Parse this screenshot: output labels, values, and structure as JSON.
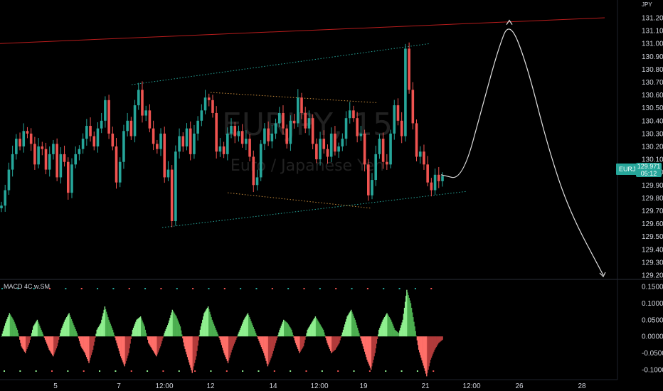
{
  "symbol": "EURJPY",
  "watermark": {
    "symbol": "EURJPY, 15",
    "description": "Euro / Japanese Yen"
  },
  "corner_label": "JPY",
  "last_price": {
    "label": "EURJPY",
    "value": "129.971",
    "countdown": "05:12"
  },
  "macd_title": "MACD 4C w.SM",
  "colors": {
    "background": "#000000",
    "candle_up": "#26a69a",
    "candle_down": "#ef5350",
    "channel_green": "#26a69a",
    "channel_orange": "#c68a3a",
    "resistance_red": "#b71c1c",
    "projection": "#e0e0e0",
    "macd_up": "#8ff08f",
    "macd_up_dark": "#4caf50",
    "macd_down": "#ff6f69",
    "macd_down_dark": "#b23b3b"
  },
  "chart_data": [
    {
      "type": "candlestick",
      "title": "EURJPY, 15",
      "y_axis": {
        "ylim": [
          129.2,
          131.2
        ],
        "ticks": [
          "131.200",
          "131.100",
          "131.000",
          "130.900",
          "130.800",
          "130.700",
          "130.600",
          "130.500",
          "130.400",
          "130.300",
          "130.200",
          "130.100",
          "130.000",
          "129.900",
          "129.800",
          "129.700",
          "129.600",
          "129.500",
          "129.400",
          "129.300",
          "129.200"
        ]
      },
      "x_axis": {
        "ticks": [
          "5",
          "7",
          "12:00",
          "12",
          "14",
          "12:00",
          "19",
          "21",
          "12:00",
          "26",
          "28"
        ]
      },
      "price_path_close": [
        129.74,
        129.86,
        130.02,
        130.14,
        130.26,
        130.2,
        130.32,
        130.3,
        130.22,
        130.06,
        130.2,
        130.18,
        130.02,
        130.14,
        130.22,
        129.96,
        130.14,
        130.08,
        129.84,
        130.06,
        130.14,
        130.18,
        130.26,
        130.36,
        130.28,
        130.2,
        130.34,
        130.4,
        130.56,
        130.3,
        130.2,
        129.92,
        130.08,
        130.32,
        130.4,
        130.28,
        130.52,
        130.64,
        130.44,
        130.48,
        130.34,
        130.22,
        130.18,
        130.3,
        129.96,
        130.02,
        129.62,
        130.16,
        130.28,
        130.2,
        130.34,
        130.14,
        130.3,
        130.4,
        130.48,
        130.58,
        130.56,
        130.46,
        130.16,
        130.2,
        130.14,
        130.3,
        130.36,
        130.28,
        130.32,
        130.22,
        130.26,
        130.12,
        129.9,
        129.96,
        130.22,
        130.34,
        130.24,
        130.3,
        130.38,
        130.46,
        130.34,
        130.22,
        130.4,
        130.38,
        130.58,
        130.46,
        130.34,
        130.42,
        130.22,
        130.1,
        130.26,
        130.18,
        130.12,
        130.3,
        130.16,
        130.2,
        130.26,
        130.42,
        130.48,
        130.42,
        130.28,
        130.3,
        130.06,
        129.82,
        129.94,
        130.14,
        130.26,
        130.08,
        130.06,
        130.3,
        130.52,
        130.4,
        130.28,
        130.96,
        130.64,
        130.38,
        130.12,
        130.16,
        130.06,
        129.92,
        129.86,
        129.98,
        129.93,
        129.97
      ],
      "annotations": [
        {
          "kind": "horizontal-resistance",
          "from": [
            0,
            131.0
          ],
          "to": [
            850,
            131.2
          ]
        },
        {
          "kind": "rising-channel-top",
          "from": [
            185,
            130.68
          ],
          "to": [
            605,
            131.0
          ]
        },
        {
          "kind": "rising-channel-bottom",
          "from": [
            228,
            129.57
          ],
          "to": [
            655,
            129.85
          ]
        },
        {
          "kind": "falling-wedge-top",
          "from": [
            296,
            130.62
          ],
          "to": [
            530,
            130.54
          ]
        },
        {
          "kind": "falling-wedge-bottom",
          "from": [
            320,
            129.84
          ],
          "to": [
            522,
            129.72
          ]
        },
        {
          "kind": "projection-path",
          "points": [
            [
              620,
              129.98
            ],
            [
              650,
              129.94
            ],
            [
              680,
              130.55
            ],
            [
              700,
              130.95
            ],
            [
              716,
              131.18
            ],
            [
              740,
              130.85
            ],
            [
              770,
              130.2
            ],
            [
              800,
              129.7
            ],
            [
              848,
              129.2
            ]
          ]
        }
      ]
    },
    {
      "type": "bar",
      "title": "MACD 4C w.SM",
      "y_axis": {
        "ylim": [
          -0.1,
          0.15
        ],
        "ticks": [
          "0.1500",
          "0.1000",
          "0.0500",
          "0.0000",
          "-0.0500",
          "-0.1000"
        ]
      },
      "histogram": [
        0.0,
        0.04,
        0.07,
        0.05,
        0.02,
        -0.03,
        -0.05,
        -0.02,
        0.03,
        0.05,
        0.02,
        -0.01,
        -0.04,
        -0.06,
        -0.03,
        0.02,
        0.05,
        0.07,
        0.04,
        0.01,
        -0.03,
        -0.05,
        -0.08,
        -0.04,
        0.02,
        0.04,
        0.09,
        0.05,
        0.02,
        -0.02,
        -0.06,
        -0.09,
        -0.05,
        0.02,
        0.05,
        0.06,
        0.03,
        -0.02,
        -0.04,
        -0.06,
        -0.03,
        0.01,
        0.04,
        0.08,
        0.06,
        0.03,
        -0.03,
        -0.07,
        -0.11,
        -0.06,
        0.02,
        0.07,
        0.09,
        0.05,
        0.02,
        -0.01,
        -0.05,
        -0.08,
        -0.04,
        -0.01,
        0.02,
        0.05,
        0.07,
        0.04,
        0.01,
        -0.02,
        -0.05,
        -0.09,
        -0.06,
        -0.02,
        0.02,
        0.05,
        0.04,
        0.02,
        -0.02,
        -0.05,
        -0.03,
        0.02,
        0.04,
        0.06,
        0.04,
        0.02,
        -0.02,
        -0.05,
        -0.04,
        -0.02,
        0.02,
        0.06,
        0.08,
        0.05,
        0.01,
        -0.03,
        -0.07,
        -0.1,
        -0.05,
        0.02,
        0.05,
        0.07,
        0.05,
        0.02,
        0.01,
        0.05,
        0.14,
        0.1,
        0.03,
        -0.04,
        -0.08,
        -0.12,
        -0.07,
        -0.04,
        -0.02,
        -0.01
      ]
    }
  ]
}
